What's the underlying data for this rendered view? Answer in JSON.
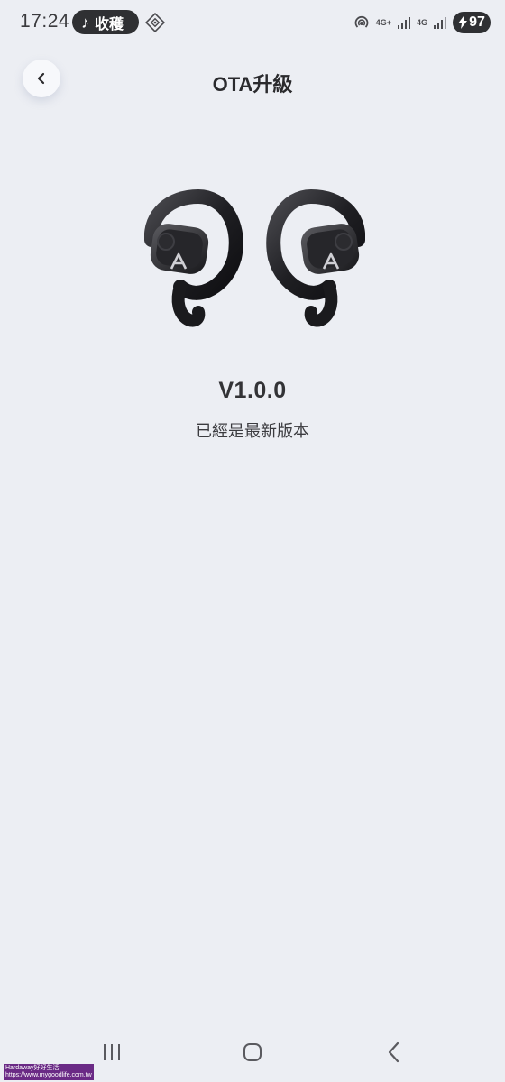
{
  "status_bar": {
    "time": "17:24",
    "music_label": "收穫",
    "network_1": "4G+",
    "network_2": "4G",
    "battery": "97"
  },
  "header": {
    "title": "OTA升級"
  },
  "firmware": {
    "version": "V1.0.0",
    "message": "已經是最新版本"
  },
  "watermark": {
    "line1": "Hardaway好好生活",
    "line2": "https://www.mygoodlife.com.tw"
  },
  "icons": {
    "back": "chevron-left-icon",
    "recent_apps": "recent-apps-icon",
    "home": "home-icon",
    "nav_back": "nav-back-icon"
  }
}
